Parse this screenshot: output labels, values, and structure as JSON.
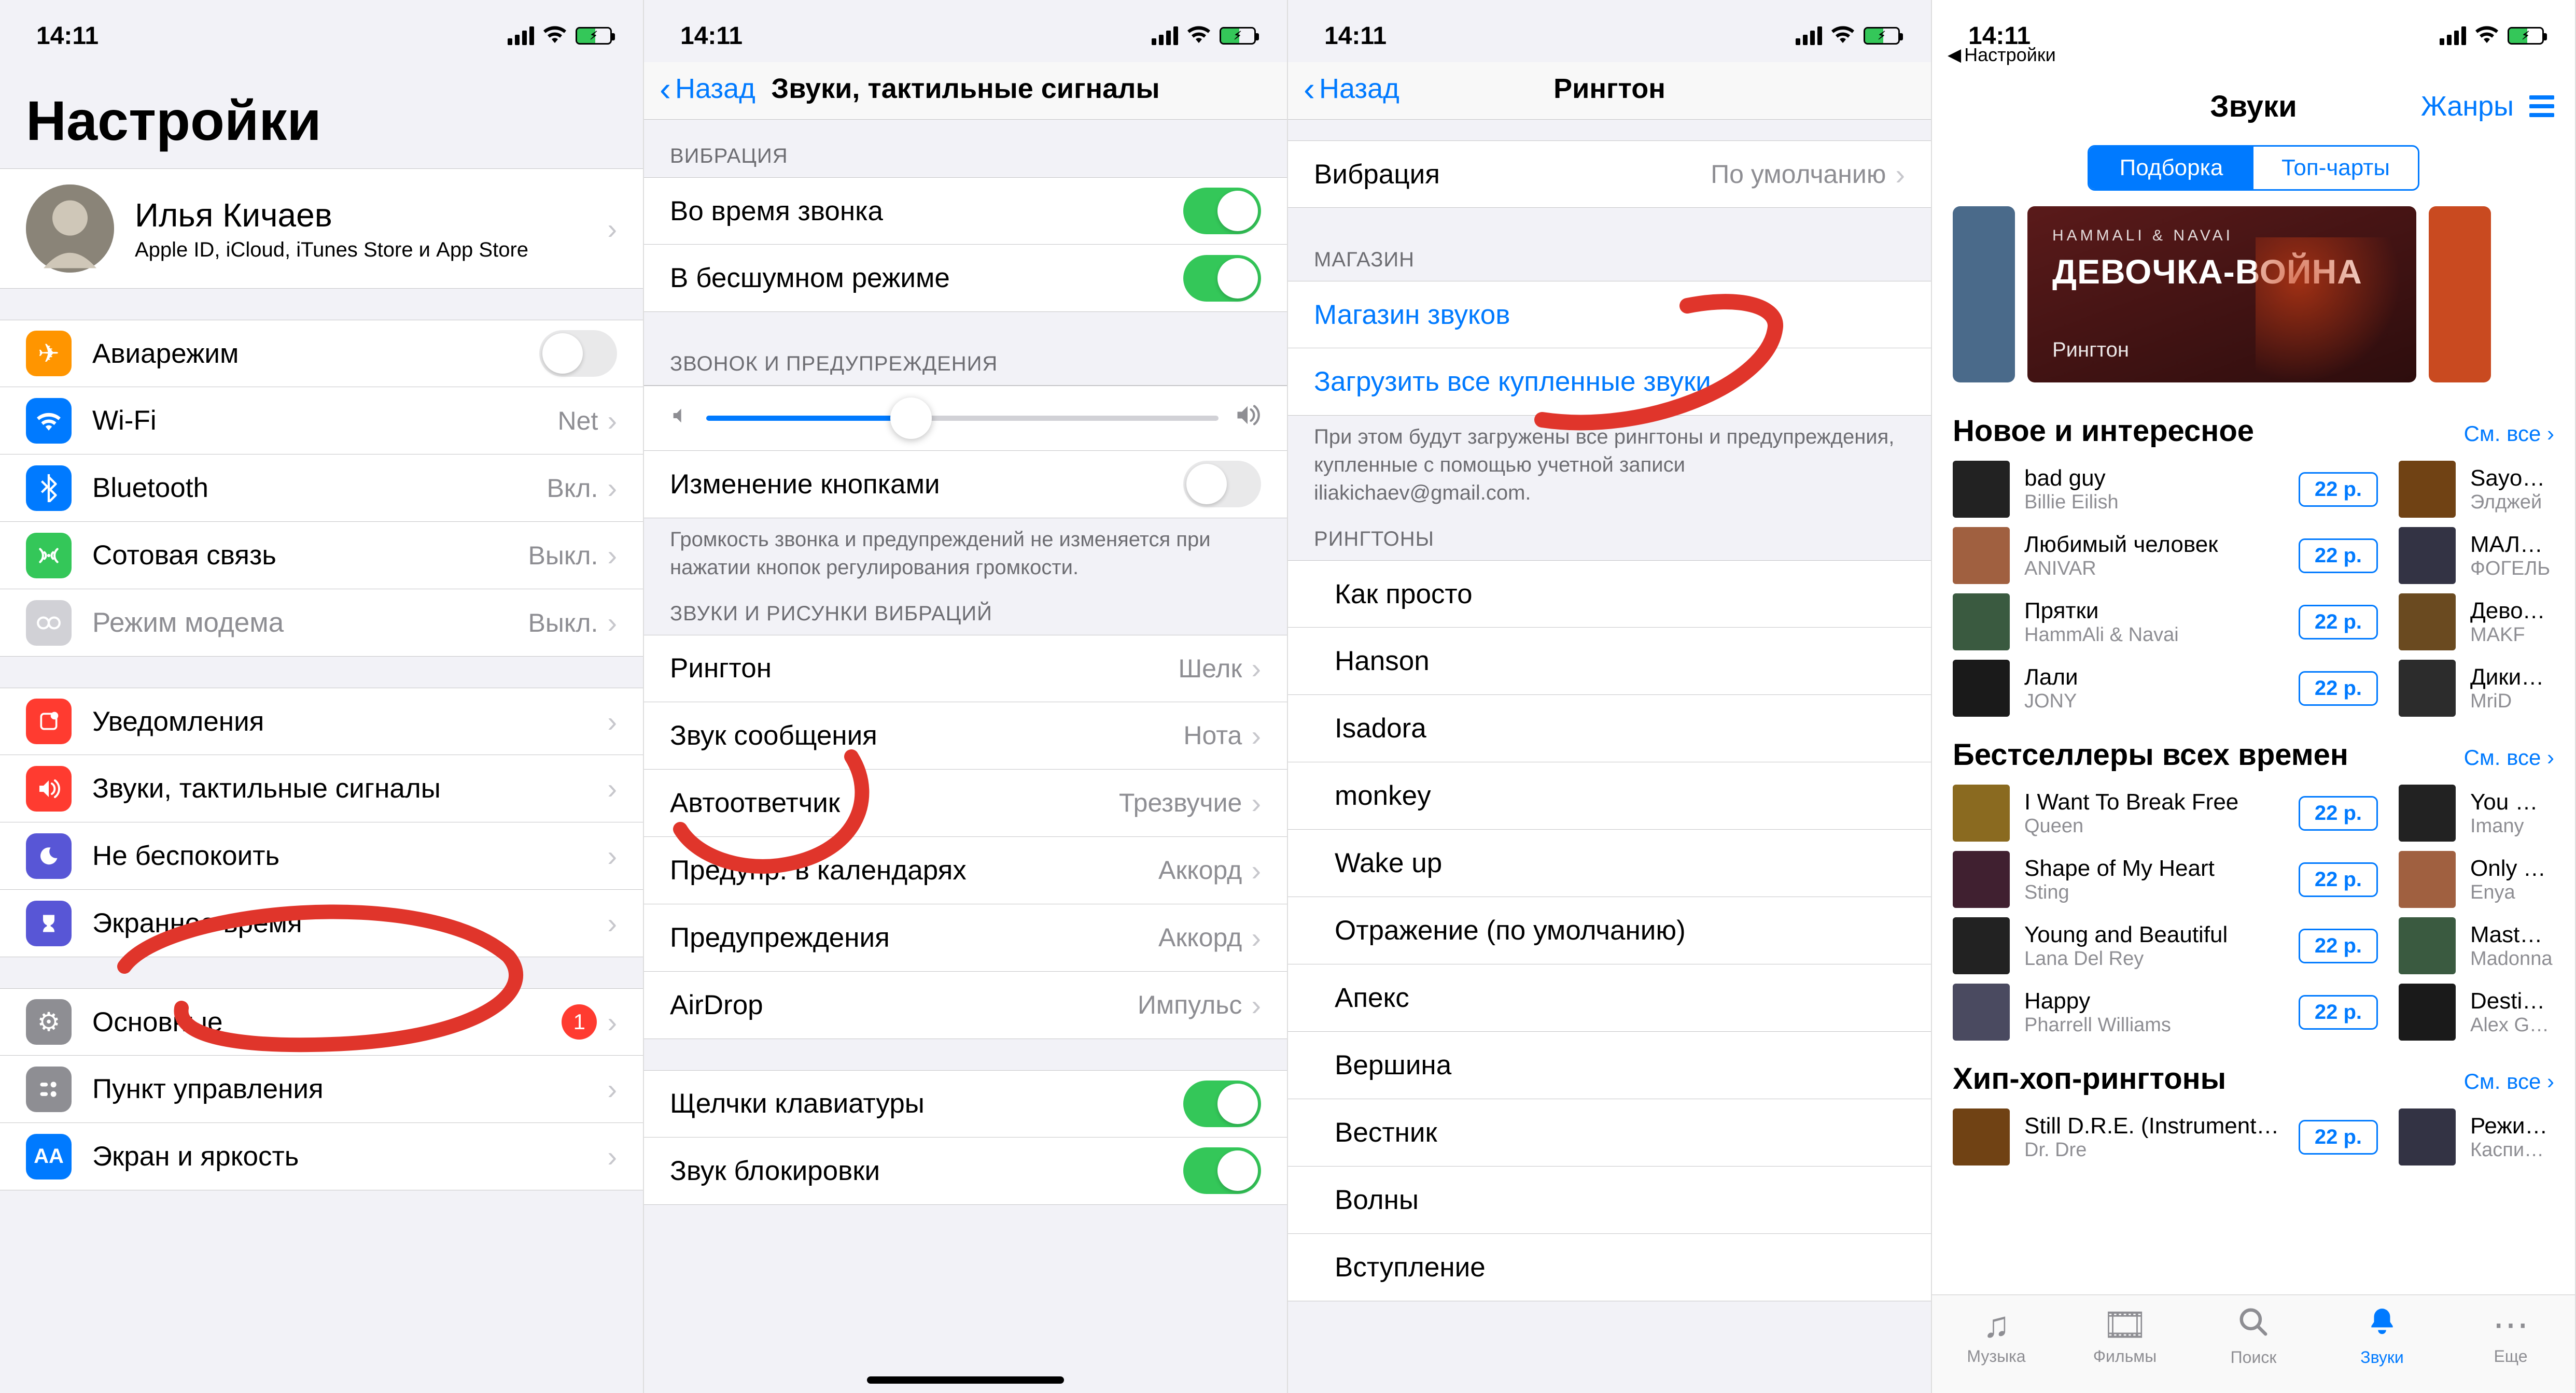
{
  "status": {
    "time": "14:11"
  },
  "s1": {
    "breadcrumb_back": "Настройки",
    "title": "Настройки",
    "profile": {
      "name": "Илья Кичаев",
      "sub": "Apple ID, iCloud, iTunes Store и App Store"
    },
    "rows": {
      "airplane": "Авиарежим",
      "wifi": "Wi-Fi",
      "wifi_val": "Net",
      "bt": "Bluetooth",
      "bt_val": "Вкл.",
      "cellular": "Сотовая связь",
      "cellular_val": "Выкл.",
      "hotspot": "Режим модема",
      "hotspot_val": "Выкл.",
      "notif": "Уведомления",
      "sounds": "Звуки, тактильные сигналы",
      "dnd": "Не беспокоить",
      "screentime": "Экранное время",
      "general": "Основные",
      "general_badge": "1",
      "control": "Пункт управления",
      "display": "Экран и яркость"
    }
  },
  "s2": {
    "back": "Назад",
    "title": "Звуки, тактильные сигналы",
    "sec_vibration": "ВИБРАЦИЯ",
    "vib_ring": "Во время звонка",
    "vib_silent": "В бесшумном режиме",
    "sec_ringer": "ЗВОНОК И ПРЕДУПРЕЖДЕНИЯ",
    "change_buttons": "Изменение кнопками",
    "footer1": "Громкость звонка и предупреждений не изменяется при нажатии кнопок регулирования громкости.",
    "sec_sounds": "ЗВУКИ И РИСУНКИ ВИБРАЦИЙ",
    "ringtone": "Рингтон",
    "ringtone_val": "Шелк",
    "text": "Звук сообщения",
    "text_val": "Нота",
    "voicemail": "Автоответчик",
    "voicemail_val": "Трезвучие",
    "cal": "Предупр. в календарях",
    "cal_val": "Аккорд",
    "alerts": "Предупреждения",
    "alerts_val": "Аккорд",
    "airdrop": "AirDrop",
    "airdrop_val": "Импульс",
    "keyclick": "Щелчки клавиатуры",
    "locksound": "Звук блокировки"
  },
  "s3": {
    "back": "Назад",
    "title": "Рингтон",
    "vibration": "Вибрация",
    "vibration_val": "По умолчанию",
    "sec_store": "МАГАЗИН",
    "store": "Магазин звуков",
    "download_all": "Загрузить все купленные звуки",
    "footer": "При этом будут загружены все рингтоны и предупреждения, купленные с помощью учетной записи iliakichaev@gmail.com.",
    "sec_ringtones": "РИНГТОНЫ",
    "items": [
      "Как просто",
      "Hanson",
      "Isadora",
      "monkey",
      "Wake up",
      "Отражение (по умолчанию)",
      "Апекс",
      "Вершина",
      "Вестник",
      "Волны",
      "Вступление"
    ]
  },
  "s4": {
    "breadcrumb": "Настройки",
    "title": "Звуки",
    "genres": "Жанры",
    "seg_a": "Подборка",
    "seg_b": "Топ-чарты",
    "banner": {
      "sub": "HAMMALI & NAVAI",
      "title": "ДЕВОЧКА-ВОЙНА",
      "foot": "Рингтон"
    },
    "sec1": "Новое и интересное",
    "sec2": "Бестселлеры всех времен",
    "sec3": "Хип-хоп-рингтоны",
    "see_all": "См. все",
    "price": "22 р.",
    "new_left": [
      {
        "t": "bad guy",
        "a": "Billie Eilish"
      },
      {
        "t": "Любимый человек",
        "a": "ANIVAR"
      },
      {
        "t": "Прятки",
        "a": "HammAli & Navai"
      },
      {
        "t": "Лали",
        "a": "JONY"
      }
    ],
    "new_right": [
      {
        "t": "Sayonara д",
        "a": "Элджей"
      },
      {
        "t": "МАЛОЛЕТ",
        "a": "ФОГЕЛЬ"
      },
      {
        "t": "Девочка к",
        "a": "MAKF"
      },
      {
        "t": "Дикий яд",
        "a": "MriD"
      }
    ],
    "best_left": [
      {
        "t": "I Want To Break Free",
        "a": "Queen"
      },
      {
        "t": "Shape of My Heart",
        "a": "Sting"
      },
      {
        "t": "Young and Beautiful",
        "a": "Lana Del Rey"
      },
      {
        "t": "Happy",
        "a": "Pharrell Williams"
      }
    ],
    "best_right": [
      {
        "t": "You Will N",
        "a": "Imany"
      },
      {
        "t": "Only Time",
        "a": "Enya"
      },
      {
        "t": "Masterpiec",
        "a": "Madonna"
      },
      {
        "t": "Destination",
        "a": "Alex Gaudin"
      }
    ],
    "hip_left": [
      {
        "t": "Still D.R.E. (Instrument…",
        "a": "Dr. Dre"
      }
    ],
    "hip_right": [
      {
        "t": "Режим ум",
        "a": "Каспийски"
      }
    ],
    "tabs": {
      "music": "Музыка",
      "films": "Фильмы",
      "search": "Поиск",
      "sounds": "Звуки",
      "more": "Еще"
    }
  }
}
